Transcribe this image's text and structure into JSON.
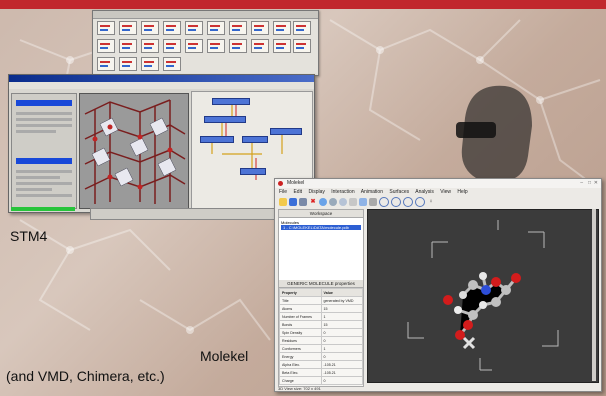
{
  "captions": {
    "stm4": "STM4",
    "molekel_line1": "Molekel",
    "molekel_line2": "(and VMD, Chimera, etc.)"
  },
  "molekel": {
    "title": "Molekel",
    "menu": [
      "File",
      "Edit",
      "Display",
      "Interaction",
      "Animation",
      "Surfaces",
      "Analysis",
      "View",
      "Help"
    ],
    "tools": [
      "open-icon",
      "save-icon",
      "export-icon",
      "delete-icon",
      "molecule-icon",
      "settings-icon",
      "reset-icon",
      "measure-icon",
      "select-icon",
      "rotate-icon",
      "zoom-icon",
      "pan-icon",
      "play-icon",
      "stop-icon",
      "person-icon"
    ],
    "workspace_title": "Workspace",
    "tree_root": "Molecules",
    "tree_selected": "1 - C:\\MOLEKEL\\DATA\\molecule.pdb",
    "props_title": "GENERIC MOLECULE properties",
    "props_headers": [
      "Property",
      "Value"
    ],
    "props": [
      [
        "Title",
        "generated by VMD"
      ],
      [
        "Atoms",
        "15"
      ],
      [
        "Number of Frames",
        "1"
      ],
      [
        "Bonds",
        "15"
      ],
      [
        "Spin Density",
        "0"
      ],
      [
        "Residues",
        "0"
      ],
      [
        "Conformers",
        "1"
      ],
      [
        "Energy",
        "0"
      ],
      [
        "Alpha Elec.",
        "-105.21"
      ],
      [
        "Beta Elec.",
        "-105.21"
      ],
      [
        "Charge",
        "0"
      ]
    ],
    "status": "3D View size: 702 x 491"
  },
  "colors": {
    "accent": "#c1272d",
    "selection": "#2d5fd3",
    "viewport": "#3b3b3b"
  }
}
